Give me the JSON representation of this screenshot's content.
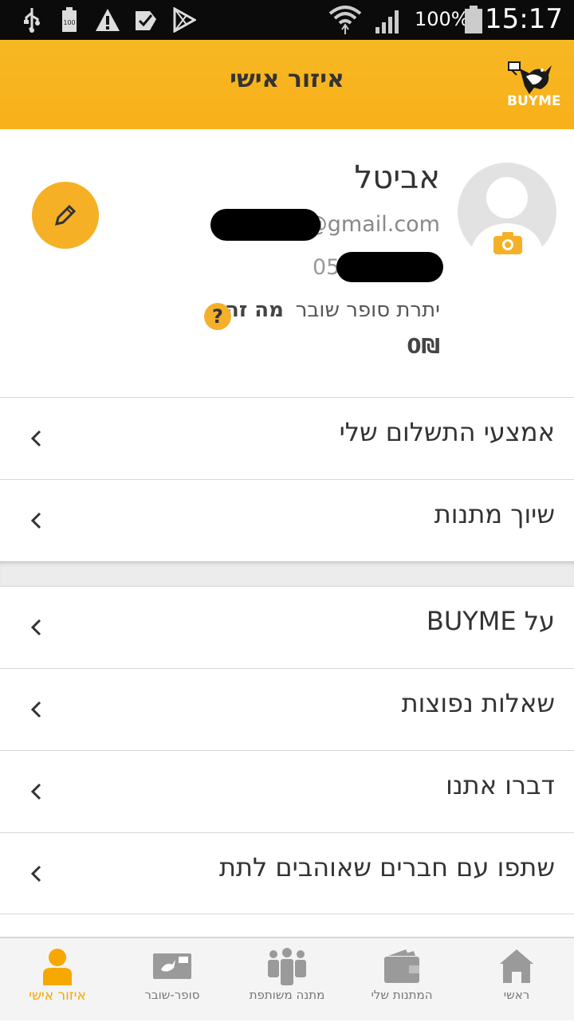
{
  "status_bar": {
    "battery_percent": "100%",
    "time": "15:17",
    "icons": [
      "usb-icon",
      "battery-100-icon",
      "warning-icon",
      "checkbox-icon",
      "play-store-icon",
      "wifi-icon",
      "signal-icon",
      "battery-icon"
    ]
  },
  "app_bar": {
    "title": "איזור אישי",
    "logo_text": "BUYME"
  },
  "profile": {
    "name": "אביטל",
    "email_suffix": "@gmail.com",
    "phone_prefix": "054",
    "balance_label": "יתרת סופר שובר",
    "what_is_label": "מה זה",
    "balance_value": "0₪"
  },
  "menu_group_1": [
    {
      "label": "אמצעי התשלום שלי"
    },
    {
      "label": "שיוך מתנות"
    }
  ],
  "menu_group_2": [
    {
      "label": "על BUYME"
    },
    {
      "label": "שאלות נפוצות"
    },
    {
      "label": "דברו אתנו"
    },
    {
      "label": "שתפו עם חברים שאוהבים לתת"
    }
  ],
  "bottom_nav": [
    {
      "label": "איזור אישי",
      "icon": "person-icon",
      "active": true
    },
    {
      "label": "סופר-שובר",
      "icon": "voucher-card-icon",
      "active": false
    },
    {
      "label": "מתנה משותפת",
      "icon": "group-icon",
      "active": false
    },
    {
      "label": "המתנות שלי",
      "icon": "wallet-icon",
      "active": false
    },
    {
      "label": "ראשי",
      "icon": "home-icon",
      "active": false
    }
  ],
  "colors": {
    "accent": "#f6b025",
    "active_nav": "#f6a800",
    "status_bar": "#0b0b0b"
  }
}
